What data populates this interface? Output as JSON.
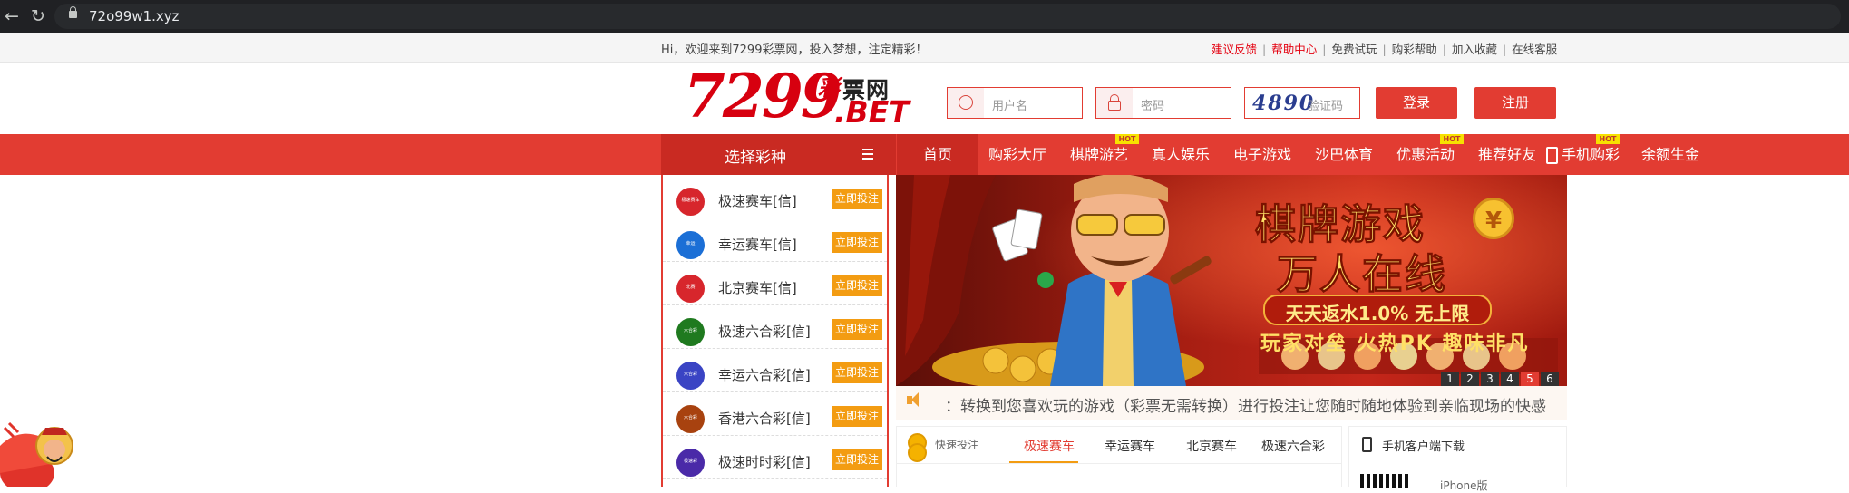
{
  "browser": {
    "url": "72o99w1.xyz"
  },
  "top_bar": {
    "welcome": "Hi，欢迎来到7299彩票网，投入梦想，注定精彩！",
    "links": [
      "建议反馈",
      "帮助中心",
      "免费试玩",
      "购彩帮助",
      "加入收藏",
      "在线客服"
    ]
  },
  "logo": {
    "number": "7299",
    "cai": "彩",
    "wang": "票网",
    "bet": ".BET"
  },
  "login": {
    "username_placeholder": "用户名",
    "password_placeholder": "密码",
    "captcha_code": "4890",
    "captcha_placeholder": "验证码",
    "login_label": "登录",
    "register_label": "注册"
  },
  "nav": {
    "select_title": "选择彩种",
    "items": [
      "首页",
      "购彩大厅",
      "棋牌游艺",
      "真人娱乐",
      "电子游戏",
      "沙巴体育",
      "优惠活动",
      "推荐好友",
      "手机购彩",
      "余额生金"
    ],
    "hot_badge": "HOT"
  },
  "lotteries": [
    {
      "name": "极速赛车[信]",
      "ball_text": "极速赛车",
      "color": "#d7262c"
    },
    {
      "name": "幸运赛车[信]",
      "ball_text": "幸运",
      "color": "#1b6fd6"
    },
    {
      "name": "北京赛车[信]",
      "ball_text": "北赛",
      "color": "#d7262c"
    },
    {
      "name": "极速六合彩[信]",
      "ball_text": "六合彩",
      "color": "#1f7a1f"
    },
    {
      "name": "幸运六合彩[信]",
      "ball_text": "六合彩",
      "color": "#3a44c4"
    },
    {
      "name": "香港六合彩[信]",
      "ball_text": "六合彩",
      "color": "#a8420f"
    },
    {
      "name": "极速时时彩[信]",
      "ball_text": "极速彩",
      "color": "#4a2aa8"
    }
  ],
  "bet_now_label": "立即投注",
  "banner": {
    "title_line1": "棋牌游戏",
    "title_line2": "万人在线",
    "ribbon": "天天返水1.0% 无上限",
    "subtitle": "玩家对垒 火热PK 趣味非凡",
    "pages": [
      "1",
      "2",
      "3",
      "4",
      "5",
      "6"
    ],
    "active_page": "5"
  },
  "notice": "：转换到您喜欢玩的游戏（彩票无需转换）进行投注让您随时随地体验到亲临现场的快感",
  "quick_bet": {
    "label": "快速投注",
    "tabs": [
      "极速赛车",
      "幸运赛车",
      "北京赛车",
      "极速六合彩"
    ],
    "active_tab": "极速赛车"
  },
  "app_download": {
    "label": "手机客户端下载",
    "iphone": "iPhone版"
  }
}
